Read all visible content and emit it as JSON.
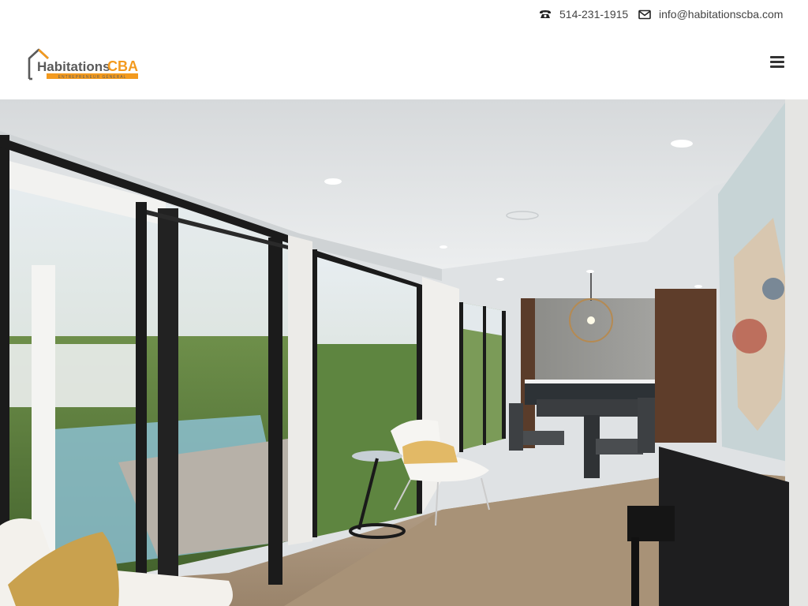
{
  "contact": {
    "phone": "514-231-1915",
    "email": "info@habitationscba.com"
  },
  "logo": {
    "name_part1": "Habitations",
    "name_part2": "CBA",
    "tagline": "ENTREPRENEUR GÉNÉRAL"
  },
  "icons": {
    "phone": "phone-icon",
    "email": "envelope-icon",
    "menu": "hamburger-menu-icon"
  },
  "colors": {
    "brand_orange": "#f39a1e",
    "brand_gray": "#5a5a5a",
    "text": "#444444"
  },
  "hero": {
    "alt": "Modern renovated dining room with large sliding glass doors"
  }
}
